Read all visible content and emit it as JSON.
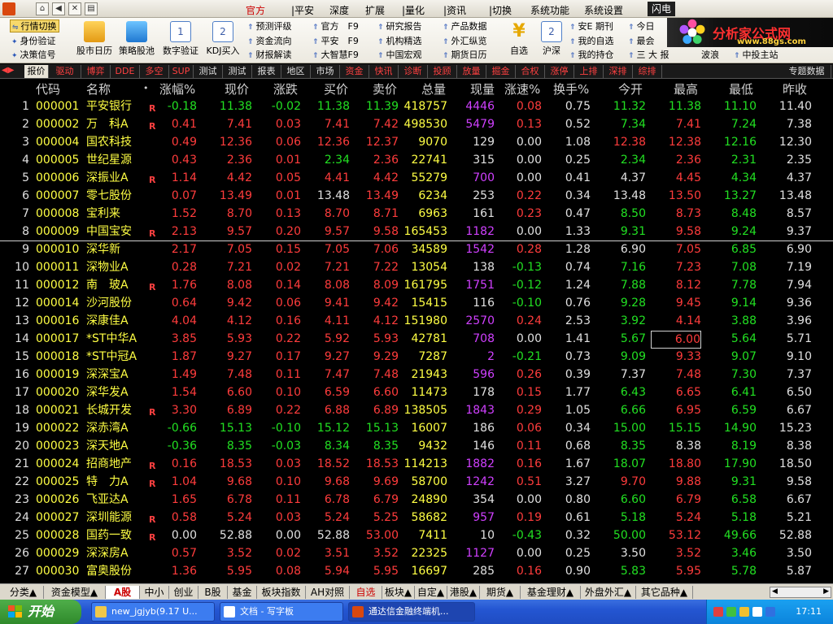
{
  "menubar": {
    "items": [
      "官方",
      "|平安",
      "深度",
      "扩展",
      "|量化",
      "|资讯",
      "|切换",
      "系统功能",
      "系统设置"
    ],
    "flash": "闪电"
  },
  "toolbar": {
    "highlight": "行情切换",
    "links_col1": [
      "身份验证",
      "决策信号"
    ],
    "big_icons": [
      "股市日历",
      "策略股池",
      "数字验证",
      "KDJ买入"
    ],
    "links_col2": [
      "预测评级",
      "资金流向",
      "财报解读"
    ],
    "links_col3": [
      "官方　F9",
      "平安　F9",
      "大智慧F9"
    ],
    "links_col4": [
      "研究报告",
      "机构精选",
      "中国宏观"
    ],
    "links_col5": [
      "产品数据",
      "外汇纵览",
      "期货日历"
    ],
    "big_icons2": [
      "自选",
      "沪深"
    ],
    "links_col6": [
      "安E 期刊",
      "我的自选",
      "我的持仓"
    ],
    "links_col7": [
      "今日",
      "最会",
      "三 大 报"
    ],
    "links_col8": [
      "波浪"
    ],
    "links_col9": [
      "中投主站"
    ],
    "brand_title": "分析家公式网",
    "brand_url": "www.88gs.com"
  },
  "tabs": [
    "报价",
    "驱动",
    "博弈",
    "DDE",
    "多空",
    "SUP",
    "测试",
    "测试",
    "报表",
    "地区",
    "市场",
    "资金",
    "快讯",
    "诊断",
    "投顾",
    "放量",
    "掘金",
    "合权",
    "涨停",
    "上排",
    "深排",
    "综排",
    "专题数据"
  ],
  "columns": {
    "code": "代码",
    "name": "名称",
    "dot": "•",
    "chg_pct": "涨幅%",
    "price": "现价",
    "diff": "涨跌",
    "bid": "买价",
    "ask": "卖价",
    "volume": "总量",
    "cur_vol": "现量",
    "speed": "涨速%",
    "turnover": "换手%",
    "open": "今开",
    "high": "最高",
    "low": "最低",
    "prev": "昨收"
  },
  "rows": [
    {
      "idx": "1",
      "code": "000001",
      "name": "平安银行",
      "flag": "R",
      "chg": "-0.18",
      "price": "11.38",
      "diff": "-0.02",
      "bid": "11.38",
      "ask": "11.39",
      "vol": "418757",
      "cur": "4446",
      "spd": "0.08",
      "turn": "0.75",
      "open": "11.32",
      "high": "11.38",
      "low": "11.10",
      "prev": "11.40",
      "tone": "down",
      "open_tone": "down",
      "high_tone": "down",
      "low_tone": "down",
      "cur_tone": "purple",
      "spd_tone": "up"
    },
    {
      "idx": "2",
      "code": "000002",
      "name": "万　科A",
      "flag": "R",
      "chg": "0.41",
      "price": "7.41",
      "diff": "0.03",
      "bid": "7.41",
      "ask": "7.42",
      "vol": "498530",
      "cur": "5479",
      "spd": "0.13",
      "turn": "0.52",
      "open": "7.34",
      "high": "7.41",
      "low": "7.24",
      "prev": "7.38",
      "tone": "up",
      "open_tone": "down",
      "high_tone": "up",
      "low_tone": "down",
      "cur_tone": "purple",
      "spd_tone": "up"
    },
    {
      "idx": "3",
      "code": "000004",
      "name": "国农科技",
      "flag": "",
      "chg": "0.49",
      "price": "12.36",
      "diff": "0.06",
      "bid": "12.36",
      "ask": "12.37",
      "vol": "9070",
      "cur": "129",
      "spd": "0.00",
      "turn": "1.08",
      "open": "12.38",
      "high": "12.38",
      "low": "12.16",
      "prev": "12.30",
      "tone": "up",
      "open_tone": "up",
      "high_tone": "up",
      "low_tone": "down",
      "cur_tone": "flat",
      "spd_tone": "flat"
    },
    {
      "idx": "4",
      "code": "000005",
      "name": "世纪星源",
      "flag": "",
      "chg": "0.43",
      "price": "2.36",
      "diff": "0.01",
      "bid": "2.34",
      "ask": "2.36",
      "vol": "22741",
      "cur": "315",
      "spd": "0.00",
      "turn": "0.25",
      "open": "2.34",
      "high": "2.36",
      "low": "2.31",
      "prev": "2.35",
      "tone": "up",
      "bid_tone": "down",
      "open_tone": "down",
      "high_tone": "up",
      "low_tone": "down",
      "cur_tone": "flat",
      "spd_tone": "flat"
    },
    {
      "idx": "5",
      "code": "000006",
      "name": "深振业A",
      "flag": "R",
      "chg": "1.14",
      "price": "4.42",
      "diff": "0.05",
      "bid": "4.41",
      "ask": "4.42",
      "vol": "55279",
      "cur": "700",
      "spd": "0.00",
      "turn": "0.41",
      "open": "4.37",
      "high": "4.45",
      "low": "4.34",
      "prev": "4.37",
      "tone": "up",
      "open_tone": "flat",
      "high_tone": "up",
      "low_tone": "down",
      "cur_tone": "purple",
      "spd_tone": "flat"
    },
    {
      "idx": "6",
      "code": "000007",
      "name": "零七股份",
      "flag": "",
      "chg": "0.07",
      "price": "13.49",
      "diff": "0.01",
      "bid": "13.48",
      "ask": "13.49",
      "vol": "6234",
      "cur": "253",
      "spd": "0.22",
      "turn": "0.34",
      "open": "13.48",
      "high": "13.50",
      "low": "13.27",
      "prev": "13.48",
      "tone": "up",
      "bid_tone": "flat",
      "open_tone": "flat",
      "high_tone": "up",
      "low_tone": "down",
      "cur_tone": "flat",
      "spd_tone": "up"
    },
    {
      "idx": "7",
      "code": "000008",
      "name": "宝利来",
      "flag": "",
      "chg": "1.52",
      "price": "8.70",
      "diff": "0.13",
      "bid": "8.70",
      "ask": "8.71",
      "vol": "6963",
      "cur": "161",
      "spd": "0.23",
      "turn": "0.47",
      "open": "8.50",
      "high": "8.73",
      "low": "8.48",
      "prev": "8.57",
      "tone": "up",
      "open_tone": "down",
      "high_tone": "up",
      "low_tone": "down",
      "cur_tone": "flat",
      "spd_tone": "up"
    },
    {
      "idx": "8",
      "code": "000009",
      "name": "中国宝安",
      "flag": "R",
      "chg": "2.13",
      "price": "9.57",
      "diff": "0.20",
      "bid": "9.57",
      "ask": "9.58",
      "vol": "165453",
      "cur": "1182",
      "spd": "0.00",
      "turn": "1.33",
      "open": "9.31",
      "high": "9.58",
      "low": "9.24",
      "prev": "9.37",
      "tone": "up",
      "open_tone": "down",
      "high_tone": "up",
      "low_tone": "down",
      "cur_tone": "purple",
      "spd_tone": "flat"
    },
    {
      "idx": "9",
      "code": "000010",
      "name": "深华新",
      "flag": "",
      "chg": "2.17",
      "price": "7.05",
      "diff": "0.15",
      "bid": "7.05",
      "ask": "7.06",
      "vol": "34589",
      "cur": "1542",
      "spd": "0.28",
      "turn": "1.28",
      "open": "6.90",
      "high": "7.05",
      "low": "6.85",
      "prev": "6.90",
      "tone": "up",
      "open_tone": "flat",
      "high_tone": "up",
      "low_tone": "down",
      "cur_tone": "purple",
      "spd_tone": "up"
    },
    {
      "idx": "10",
      "code": "000011",
      "name": "深物业A",
      "flag": "",
      "chg": "0.28",
      "price": "7.21",
      "diff": "0.02",
      "bid": "7.21",
      "ask": "7.22",
      "vol": "13054",
      "cur": "138",
      "spd": "-0.13",
      "turn": "0.74",
      "open": "7.16",
      "high": "7.23",
      "low": "7.08",
      "prev": "7.19",
      "tone": "up",
      "open_tone": "down",
      "high_tone": "up",
      "low_tone": "down",
      "cur_tone": "flat",
      "spd_tone": "down"
    },
    {
      "idx": "11",
      "code": "000012",
      "name": "南　玻A",
      "flag": "R",
      "chg": "1.76",
      "price": "8.08",
      "diff": "0.14",
      "bid": "8.08",
      "ask": "8.09",
      "vol": "161795",
      "cur": "1751",
      "spd": "-0.12",
      "turn": "1.24",
      "open": "7.88",
      "high": "8.12",
      "low": "7.78",
      "prev": "7.94",
      "tone": "up",
      "open_tone": "down",
      "high_tone": "up",
      "low_tone": "down",
      "cur_tone": "purple",
      "spd_tone": "down"
    },
    {
      "idx": "12",
      "code": "000014",
      "name": "沙河股份",
      "flag": "",
      "chg": "0.64",
      "price": "9.42",
      "diff": "0.06",
      "bid": "9.41",
      "ask": "9.42",
      "vol": "15415",
      "cur": "116",
      "spd": "-0.10",
      "turn": "0.76",
      "open": "9.28",
      "high": "9.45",
      "low": "9.14",
      "prev": "9.36",
      "tone": "up",
      "open_tone": "down",
      "high_tone": "up",
      "low_tone": "down",
      "cur_tone": "flat",
      "spd_tone": "down"
    },
    {
      "idx": "13",
      "code": "000016",
      "name": "深康佳A",
      "flag": "",
      "chg": "4.04",
      "price": "4.12",
      "diff": "0.16",
      "bid": "4.11",
      "ask": "4.12",
      "vol": "151980",
      "cur": "2570",
      "spd": "0.24",
      "turn": "2.53",
      "open": "3.92",
      "high": "4.14",
      "low": "3.88",
      "prev": "3.96",
      "tone": "up",
      "open_tone": "down",
      "high_tone": "up",
      "low_tone": "down",
      "cur_tone": "purple",
      "spd_tone": "up"
    },
    {
      "idx": "14",
      "code": "000017",
      "name": "*ST中华A",
      "flag": "",
      "chg": "3.85",
      "price": "5.93",
      "diff": "0.22",
      "bid": "5.92",
      "ask": "5.93",
      "vol": "42781",
      "cur": "708",
      "spd": "0.00",
      "turn": "1.41",
      "open": "5.67",
      "high": "6.00",
      "low": "5.64",
      "prev": "5.71",
      "tone": "up",
      "open_tone": "down",
      "high_tone": "up",
      "low_tone": "down",
      "cur_tone": "purple",
      "spd_tone": "flat",
      "high_boxed": true
    },
    {
      "idx": "15",
      "code": "000018",
      "name": "*ST中冠A",
      "flag": "",
      "chg": "1.87",
      "price": "9.27",
      "diff": "0.17",
      "bid": "9.27",
      "ask": "9.29",
      "vol": "7287",
      "cur": "2",
      "spd": "-0.21",
      "turn": "0.73",
      "open": "9.09",
      "high": "9.33",
      "low": "9.07",
      "prev": "9.10",
      "tone": "up",
      "open_tone": "down",
      "high_tone": "up",
      "low_tone": "down",
      "cur_tone": "purple",
      "spd_tone": "down"
    },
    {
      "idx": "16",
      "code": "000019",
      "name": "深深宝A",
      "flag": "",
      "chg": "1.49",
      "price": "7.48",
      "diff": "0.11",
      "bid": "7.47",
      "ask": "7.48",
      "vol": "21943",
      "cur": "596",
      "spd": "0.26",
      "turn": "0.39",
      "open": "7.37",
      "high": "7.48",
      "low": "7.30",
      "prev": "7.37",
      "tone": "up",
      "open_tone": "flat",
      "high_tone": "up",
      "low_tone": "down",
      "cur_tone": "purple",
      "spd_tone": "up"
    },
    {
      "idx": "17",
      "code": "000020",
      "name": "深华发A",
      "flag": "",
      "chg": "1.54",
      "price": "6.60",
      "diff": "0.10",
      "bid": "6.59",
      "ask": "6.60",
      "vol": "11473",
      "cur": "178",
      "spd": "0.15",
      "turn": "1.77",
      "open": "6.43",
      "high": "6.65",
      "low": "6.41",
      "prev": "6.50",
      "tone": "up",
      "open_tone": "down",
      "high_tone": "up",
      "low_tone": "down",
      "cur_tone": "flat",
      "spd_tone": "up"
    },
    {
      "idx": "18",
      "code": "000021",
      "name": "长城开发",
      "flag": "R",
      "chg": "3.30",
      "price": "6.89",
      "diff": "0.22",
      "bid": "6.88",
      "ask": "6.89",
      "vol": "138505",
      "cur": "1843",
      "spd": "0.29",
      "turn": "1.05",
      "open": "6.66",
      "high": "6.95",
      "low": "6.59",
      "prev": "6.67",
      "tone": "up",
      "open_tone": "down",
      "high_tone": "up",
      "low_tone": "down",
      "cur_tone": "purple",
      "spd_tone": "up"
    },
    {
      "idx": "19",
      "code": "000022",
      "name": "深赤湾A",
      "flag": "",
      "chg": "-0.66",
      "price": "15.13",
      "diff": "-0.10",
      "bid": "15.12",
      "ask": "15.13",
      "vol": "16007",
      "cur": "186",
      "spd": "0.06",
      "turn": "0.34",
      "open": "15.00",
      "high": "15.15",
      "low": "14.90",
      "prev": "15.23",
      "tone": "down",
      "open_tone": "down",
      "high_tone": "down",
      "low_tone": "down",
      "cur_tone": "flat",
      "spd_tone": "up"
    },
    {
      "idx": "20",
      "code": "000023",
      "name": "深天地A",
      "flag": "",
      "chg": "-0.36",
      "price": "8.35",
      "diff": "-0.03",
      "bid": "8.34",
      "ask": "8.35",
      "vol": "9432",
      "cur": "146",
      "spd": "0.11",
      "turn": "0.68",
      "open": "8.35",
      "high": "8.38",
      "low": "8.19",
      "prev": "8.38",
      "tone": "down",
      "open_tone": "down",
      "high_tone": "flat",
      "low_tone": "down",
      "cur_tone": "flat",
      "spd_tone": "up"
    },
    {
      "idx": "21",
      "code": "000024",
      "name": "招商地产",
      "flag": "R",
      "chg": "0.16",
      "price": "18.53",
      "diff": "0.03",
      "bid": "18.52",
      "ask": "18.53",
      "vol": "114213",
      "cur": "1882",
      "spd": "0.16",
      "turn": "1.67",
      "open": "18.07",
      "high": "18.80",
      "low": "17.90",
      "prev": "18.50",
      "tone": "up",
      "open_tone": "down",
      "high_tone": "up",
      "low_tone": "down",
      "cur_tone": "purple",
      "spd_tone": "up"
    },
    {
      "idx": "22",
      "code": "000025",
      "name": "特　力A",
      "flag": "R",
      "chg": "1.04",
      "price": "9.68",
      "diff": "0.10",
      "bid": "9.68",
      "ask": "9.69",
      "vol": "58700",
      "cur": "1242",
      "spd": "0.51",
      "turn": "3.27",
      "open": "9.70",
      "high": "9.88",
      "low": "9.31",
      "prev": "9.58",
      "tone": "up",
      "open_tone": "up",
      "high_tone": "up",
      "low_tone": "down",
      "cur_tone": "purple",
      "spd_tone": "up"
    },
    {
      "idx": "23",
      "code": "000026",
      "name": "飞亚达A",
      "flag": "",
      "chg": "1.65",
      "price": "6.78",
      "diff": "0.11",
      "bid": "6.78",
      "ask": "6.79",
      "vol": "24890",
      "cur": "354",
      "spd": "0.00",
      "turn": "0.80",
      "open": "6.60",
      "high": "6.79",
      "low": "6.58",
      "prev": "6.67",
      "tone": "up",
      "open_tone": "down",
      "high_tone": "up",
      "low_tone": "down",
      "cur_tone": "flat",
      "spd_tone": "flat"
    },
    {
      "idx": "24",
      "code": "000027",
      "name": "深圳能源",
      "flag": "R",
      "chg": "0.58",
      "price": "5.24",
      "diff": "0.03",
      "bid": "5.24",
      "ask": "5.25",
      "vol": "58682",
      "cur": "957",
      "spd": "0.19",
      "turn": "0.61",
      "open": "5.18",
      "high": "5.24",
      "low": "5.18",
      "prev": "5.21",
      "tone": "up",
      "open_tone": "down",
      "high_tone": "up",
      "low_tone": "down",
      "cur_tone": "purple",
      "spd_tone": "up"
    },
    {
      "idx": "25",
      "code": "000028",
      "name": "国药一致",
      "flag": "R",
      "chg": "0.00",
      "price": "52.88",
      "diff": "0.00",
      "bid": "52.88",
      "ask": "53.00",
      "vol": "7411",
      "cur": "10",
      "spd": "-0.43",
      "turn": "0.32",
      "open": "50.00",
      "high": "53.12",
      "low": "49.66",
      "prev": "52.88",
      "tone": "flat",
      "ask_tone": "up",
      "open_tone": "down",
      "high_tone": "up",
      "low_tone": "down",
      "cur_tone": "flat",
      "spd_tone": "down"
    },
    {
      "idx": "26",
      "code": "000029",
      "name": "深深房A",
      "flag": "",
      "chg": "0.57",
      "price": "3.52",
      "diff": "0.02",
      "bid": "3.51",
      "ask": "3.52",
      "vol": "22325",
      "cur": "1127",
      "spd": "0.00",
      "turn": "0.25",
      "open": "3.50",
      "high": "3.52",
      "low": "3.46",
      "prev": "3.50",
      "tone": "up",
      "open_tone": "flat",
      "high_tone": "up",
      "low_tone": "down",
      "cur_tone": "purple",
      "spd_tone": "flat"
    },
    {
      "idx": "27",
      "code": "000030",
      "name": "富奥股份",
      "flag": "",
      "chg": "1.36",
      "price": "5.95",
      "diff": "0.08",
      "bid": "5.94",
      "ask": "5.95",
      "vol": "16697",
      "cur": "285",
      "spd": "0.16",
      "turn": "0.90",
      "open": "5.83",
      "high": "5.95",
      "low": "5.78",
      "prev": "5.87",
      "tone": "up",
      "open_tone": "down",
      "high_tone": "up",
      "low_tone": "down",
      "cur_tone": "flat",
      "spd_tone": "up"
    }
  ],
  "bottom_tabs": [
    "分类▲",
    "资金模型▲",
    "A股",
    "中小",
    "创业",
    "B股",
    "基金",
    "板块指数",
    "AH对照",
    "自选",
    "板块▲",
    "自定▲",
    "港股▲",
    "期货▲",
    "基金理财▲",
    "外盘外汇▲",
    "其它品种▲"
  ],
  "taskbar": {
    "start": "开始",
    "tasks": [
      "new_jgjyb(9.17 U...",
      "文档 - 写字板",
      "通达信金融终端机..."
    ],
    "clock": "17:11"
  },
  "colors": {
    "up": "#ff3c3c",
    "down": "#22e022",
    "code": "#ffff44",
    "purple": "#d040ff"
  }
}
